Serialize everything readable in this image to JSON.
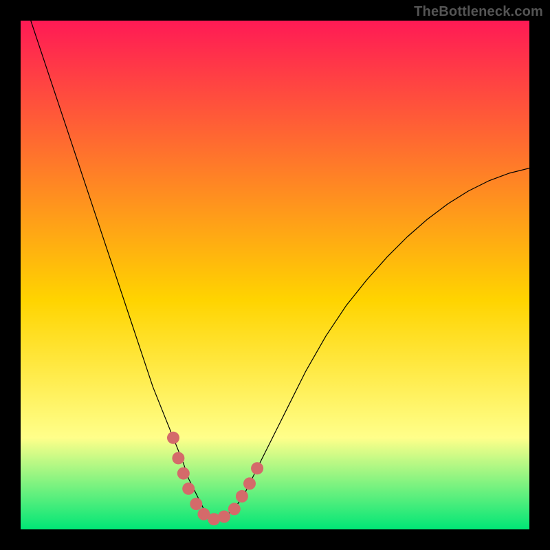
{
  "attribution": "TheBottleneck.com",
  "colors": {
    "frame_bg": "#000000",
    "grad_top": "#ff1a55",
    "grad_mid": "#ffd400",
    "grad_yellow_pale": "#ffff8a",
    "grad_bottom": "#00e676",
    "curve": "#000000",
    "marker": "#d46a6a"
  },
  "chart_data": {
    "type": "line",
    "title": "",
    "xlabel": "",
    "ylabel": "",
    "xlim": [
      0,
      100
    ],
    "ylim": [
      0,
      100
    ],
    "series": [
      {
        "name": "bottleneck-curve",
        "x": [
          2,
          4,
          6,
          8,
          10,
          12,
          14,
          16,
          18,
          20,
          22,
          24,
          26,
          28,
          30,
          32,
          33,
          34,
          35,
          36,
          37,
          38,
          39,
          40,
          42,
          44,
          46,
          48,
          50,
          52,
          54,
          56,
          58,
          60,
          64,
          68,
          72,
          76,
          80,
          84,
          88,
          92,
          96,
          100
        ],
        "values": [
          100,
          94,
          88,
          82,
          76,
          70,
          64,
          58,
          52,
          46,
          40,
          34,
          28,
          23,
          18,
          13,
          10,
          8,
          6,
          4,
          3,
          2,
          2,
          2.5,
          4,
          7,
          11,
          15,
          19,
          23,
          27,
          31,
          34.5,
          38,
          44,
          49,
          53.5,
          57.5,
          61,
          64,
          66.5,
          68.5,
          70,
          71
        ]
      }
    ],
    "markers": {
      "name": "highlight-points",
      "points": [
        {
          "x": 30,
          "y": 18
        },
        {
          "x": 31,
          "y": 14
        },
        {
          "x": 32,
          "y": 11
        },
        {
          "x": 33,
          "y": 8
        },
        {
          "x": 34.5,
          "y": 5
        },
        {
          "x": 36,
          "y": 3
        },
        {
          "x": 38,
          "y": 2
        },
        {
          "x": 40,
          "y": 2.5
        },
        {
          "x": 42,
          "y": 4
        },
        {
          "x": 43.5,
          "y": 6.5
        },
        {
          "x": 45,
          "y": 9
        },
        {
          "x": 46.5,
          "y": 12
        }
      ]
    }
  }
}
